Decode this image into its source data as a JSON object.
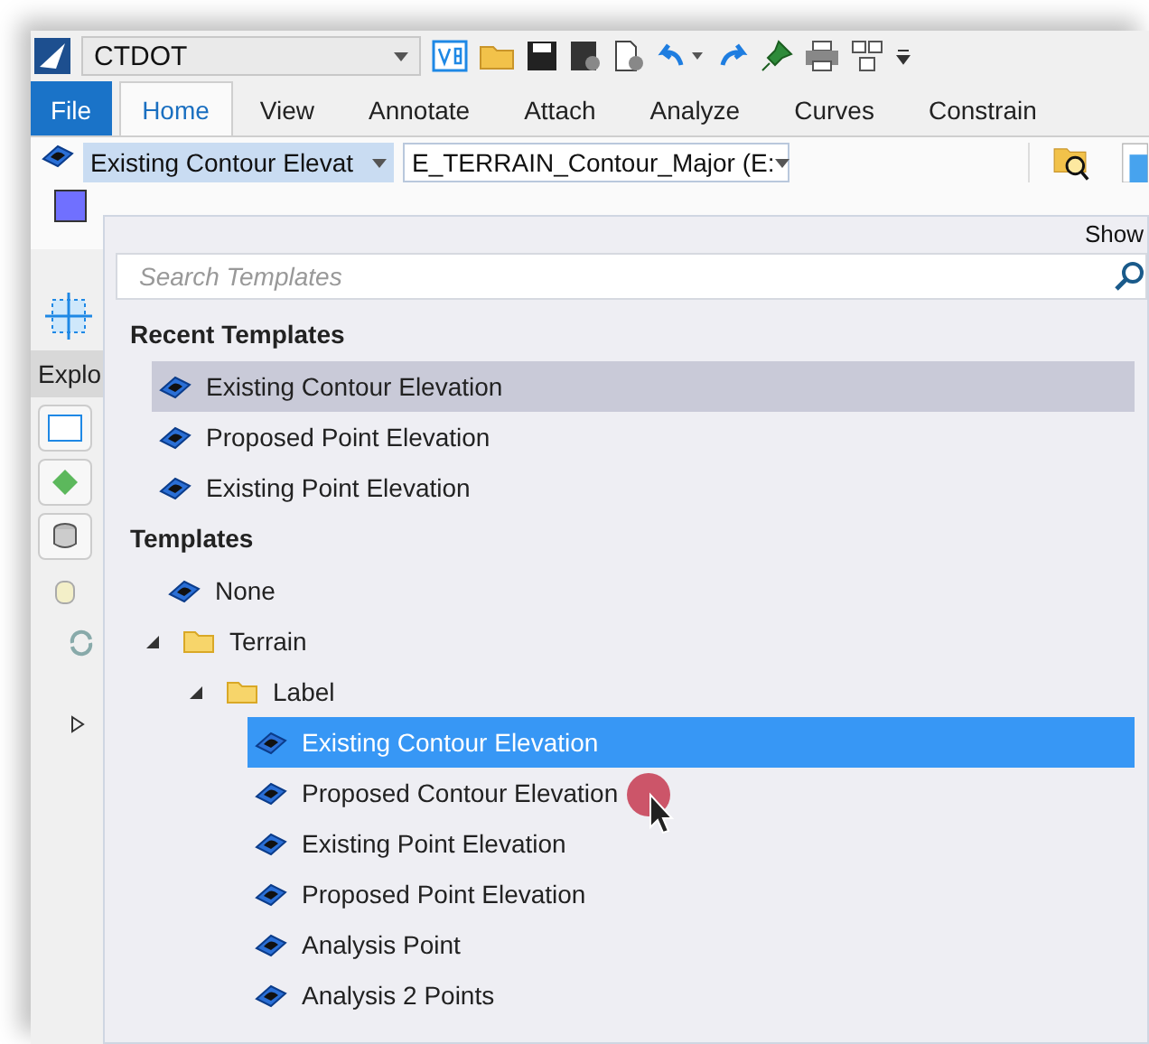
{
  "quick_access": {
    "workspace": "CTDOT"
  },
  "tabs": [
    {
      "label": "File",
      "kind": "file",
      "selected": false
    },
    {
      "label": "Home",
      "kind": "tab",
      "selected": true
    },
    {
      "label": "View",
      "kind": "tab",
      "selected": false
    },
    {
      "label": "Annotate",
      "kind": "tab",
      "selected": false
    },
    {
      "label": "Attach",
      "kind": "tab",
      "selected": false
    },
    {
      "label": "Analyze",
      "kind": "tab",
      "selected": false
    },
    {
      "label": "Curves",
      "kind": "tab",
      "selected": false
    },
    {
      "label": "Constrain",
      "kind": "tab",
      "selected": false
    }
  ],
  "ribbon": {
    "template": "Existing Contour Elevat",
    "level": "E_TERRAIN_Contour_Major (E:",
    "show_label": "Show"
  },
  "explorer": {
    "title": "Explo"
  },
  "template_picker": {
    "search": {
      "placeholder": "Search Templates"
    },
    "recent_title": "Recent Templates",
    "recent": [
      {
        "label": "Existing Contour Elevation",
        "selected": true
      },
      {
        "label": "Proposed Point Elevation",
        "selected": false
      },
      {
        "label": "Existing Point Elevation",
        "selected": false
      }
    ],
    "templates_title": "Templates",
    "tree": [
      {
        "label": "None",
        "kind": "template",
        "selected": false
      },
      {
        "label": "Terrain",
        "kind": "folder",
        "expanded": true,
        "children": [
          {
            "label": "Label",
            "kind": "folder",
            "expanded": true,
            "children": [
              {
                "label": "Existing Contour Elevation",
                "kind": "template",
                "selected": true
              },
              {
                "label": "Proposed Contour Elevation",
                "kind": "template",
                "selected": false
              },
              {
                "label": "Existing Point Elevation",
                "kind": "template",
                "selected": false
              },
              {
                "label": "Proposed Point Elevation",
                "kind": "template",
                "selected": false
              },
              {
                "label": "Analysis Point",
                "kind": "template",
                "selected": false
              },
              {
                "label": "Analysis 2 Points",
                "kind": "template",
                "selected": false
              }
            ]
          }
        ]
      }
    ]
  }
}
